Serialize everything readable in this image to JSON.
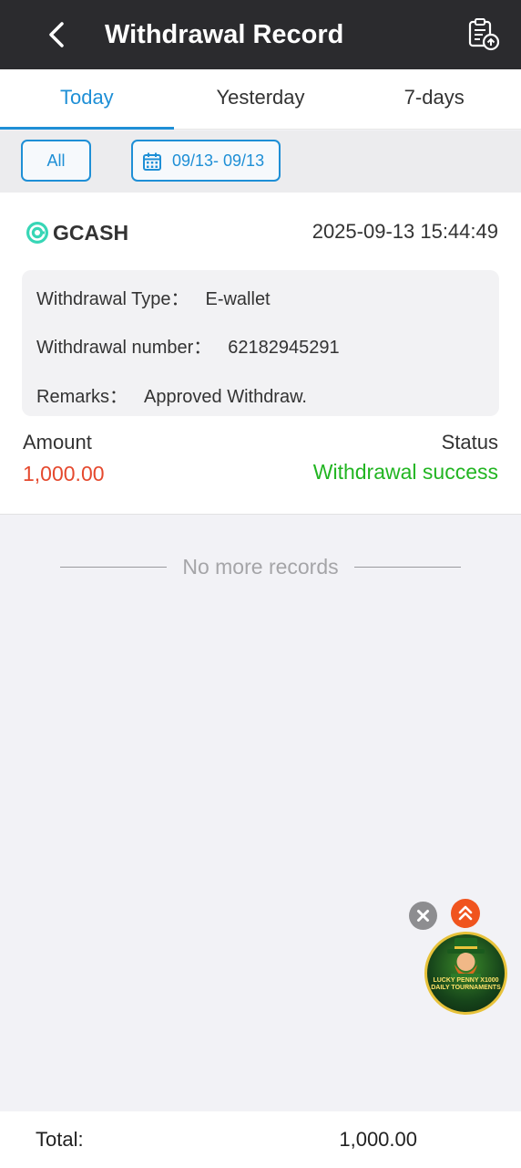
{
  "header": {
    "title": "Withdrawal Record",
    "back_icon": "chevron-left-icon",
    "export_icon": "clipboard-upload-icon"
  },
  "tabs": [
    {
      "label": "Today",
      "active": true
    },
    {
      "label": "Yesterday",
      "active": false
    },
    {
      "label": "7-days",
      "active": false
    }
  ],
  "filters": {
    "type_label": "All",
    "date_range": "09/13- 09/13",
    "date_icon": "calendar-icon"
  },
  "record": {
    "method": "GCASH",
    "method_icon": "gcash-logo-icon",
    "datetime": "2025-09-13 15:44:49",
    "type_label": "Withdrawal Type：",
    "type_value": "E-wallet",
    "number_label": "Withdrawal number：",
    "number_value": "62182945291",
    "remarks_label": "Remarks：",
    "remarks_value": "Approved Withdraw.",
    "amount_label": "Amount",
    "amount_value": "1,000.00",
    "status_label": "Status",
    "status_value": "Withdrawal success"
  },
  "list_end_text": "No more records",
  "floating": {
    "close_icon": "close-icon",
    "up_icon": "double-chevron-up-icon",
    "promo_line1": "LUCKY PENNY X1000",
    "promo_line2": "DAILY TOURNAMENTS"
  },
  "footer": {
    "total_label": "Total:",
    "total_value": "1,000.00"
  },
  "colors": {
    "accent": "#1e8fd6",
    "amount": "#e5492e",
    "success": "#22b522",
    "header_bg": "#2b2b2e"
  }
}
